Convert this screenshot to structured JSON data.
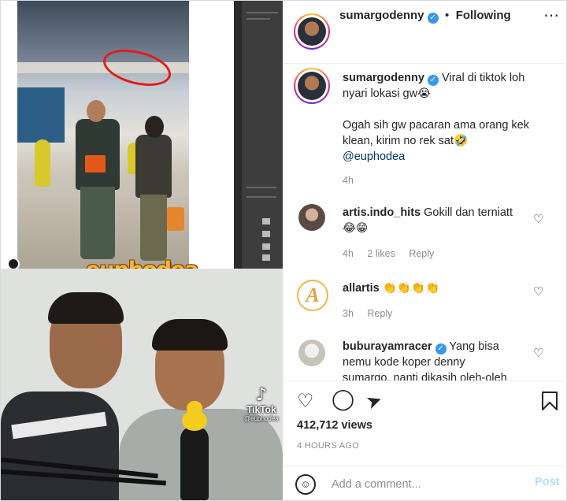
{
  "post": {
    "author": "sumargodenny",
    "separator": "•",
    "follow_status": "Following",
    "more_icon": "more-options-icon"
  },
  "caption": {
    "author": "sumargodenny",
    "line1": "Viral di tiktok loh",
    "line2": "nyari lokasi gw😭",
    "line3": "Ogah sih gw pacaran ama orang kek",
    "line4": "klean, kirim no rek sat🤣",
    "mention": "@euphodea",
    "time": "4h"
  },
  "comments": [
    {
      "author": "artis.indo_hits",
      "text": "Gokill dan terniatt",
      "text2": "😂😁",
      "time": "4h",
      "likes": "2 likes",
      "reply": "Reply"
    },
    {
      "author": "allartis",
      "text": "👏👏👏👏",
      "time": "3h",
      "reply": "Reply",
      "avatar_letter": "A"
    },
    {
      "author": "buburayamracer",
      "text": "Yang bisa",
      "text2": "nemu kode koper denny",
      "text3": "sumargo, nanti dikasih oleh-oleh"
    }
  ],
  "actions": {
    "views": "412,712 views",
    "posted": "4 HOURS AGO"
  },
  "composer": {
    "placeholder": "Add a comment...",
    "post_label": "Post"
  },
  "media": {
    "logo_text": "euphodea",
    "watermark_label": "TikTok",
    "watermark_handle": "@euphodea",
    "watermark_glyph": "♪"
  }
}
